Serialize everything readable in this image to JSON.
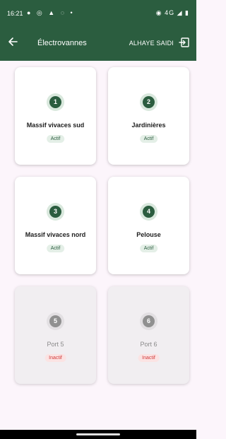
{
  "status_bar": {
    "time": "16:21",
    "left_icons": "● ◎ ▲ ◌ •",
    "right_icons": "◉ 4G ◢ ▮"
  },
  "app_bar": {
    "back_icon": "arrow-back",
    "title": "Électrovannes",
    "user": "ALHAYE SAIDI",
    "logout_icon": "logout"
  },
  "colors": {
    "primary": "#2b5d3f",
    "background": "#fcf5fb",
    "active_badge_bg": "#e4efe7",
    "inactive_badge_text": "#d33a3a"
  },
  "valves": [
    {
      "number": "1",
      "name": "Massif vivaces sud",
      "status": "Actif"
    },
    {
      "number": "2",
      "name": "Jardinières",
      "status": "Actif"
    },
    {
      "number": "3",
      "name": "Massif vivaces nord",
      "status": "Actif"
    },
    {
      "number": "4",
      "name": "Pelouse",
      "status": "Actif"
    },
    {
      "number": "5",
      "name": "Port 5",
      "status": "Inactif"
    },
    {
      "number": "6",
      "name": "Port 6",
      "status": "Inactif"
    }
  ]
}
